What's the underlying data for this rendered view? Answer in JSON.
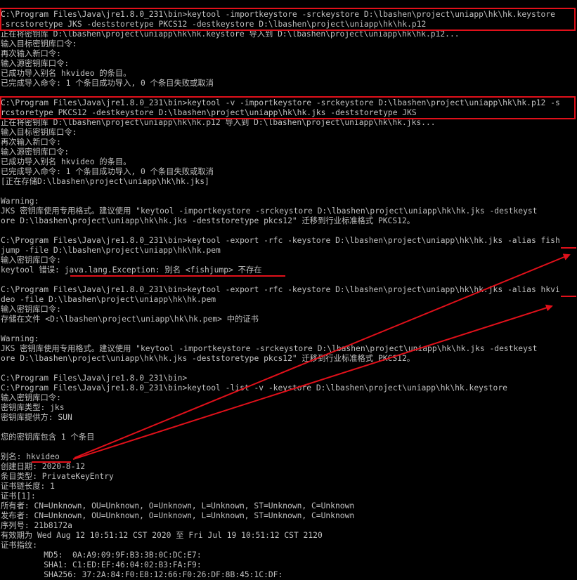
{
  "terminal": {
    "lines": [
      "C:\\Program Files\\Java\\jre1.8.0_231\\bin>keytool -importkeystore -srckeystore D:\\lbashen\\project\\uniapp\\hk\\hk.keystore",
      "-srcstoretype JKS -deststoretype PKCS12 -destkeystore D:\\lbashen\\project\\uniapp\\hk\\hk.p12",
      "正在将密钥库 D:\\lbashen\\project\\uniapp\\hk\\hk.keystore 导入到 D:\\lbashen\\project\\uniapp\\hk\\hk.p12...",
      "输入目标密钥库口令:",
      "再次输入新口令:",
      "输入源密钥库口令:",
      "已成功导入别名 hkvideo 的条目。",
      "已完成导入命令: 1 个条目成功导入, 0 个条目失败或取消",
      "",
      "C:\\Program Files\\Java\\jre1.8.0_231\\bin>keytool -v -importkeystore -srckeystore D:\\lbashen\\project\\uniapp\\hk\\hk.p12 -s",
      "rcstoretype PKCS12 -destkeystore D:\\lbashen\\project\\uniapp\\hk\\hk.jks -deststoretype JKS",
      "正在将密钥库 D:\\lbashen\\project\\uniapp\\hk\\hk.p12 导入到 D:\\lbashen\\project\\uniapp\\hk\\hk.jks...",
      "输入目标密钥库口令:",
      "再次输入新口令:",
      "输入源密钥库口令:",
      "已成功导入别名 hkvideo 的条目。",
      "已完成导入命令: 1 个条目成功导入, 0 个条目失败或取消",
      "[正在存储D:\\lbashen\\project\\uniapp\\hk\\hk.jks]",
      "",
      "Warning:",
      "JKS 密钥库使用专用格式。建议使用 \"keytool -importkeystore -srckeystore D:\\lbashen\\project\\uniapp\\hk\\hk.jks -destkeyst",
      "ore D:\\lbashen\\project\\uniapp\\hk\\hk.jks -deststoretype pkcs12\" 迁移到行业标准格式 PKCS12。",
      "",
      "C:\\Program Files\\Java\\jre1.8.0_231\\bin>keytool -export -rfc -keystore D:\\lbashen\\project\\uniapp\\hk\\hk.jks -alias fish",
      "jump -file D:\\lbashen\\project\\uniapp\\hk\\hk.pem",
      "输入密钥库口令:",
      "keytool 错误: java.lang.Exception: 别名 <fishjump> 不存在",
      "",
      "C:\\Program Files\\Java\\jre1.8.0_231\\bin>keytool -export -rfc -keystore D:\\lbashen\\project\\uniapp\\hk\\hk.jks -alias hkvi",
      "deo -file D:\\lbashen\\project\\uniapp\\hk\\hk.pem",
      "输入密钥库口令:",
      "存储在文件 <D:\\lbashen\\project\\uniapp\\hk\\hk.pem> 中的证书",
      "",
      "Warning:",
      "JKS 密钥库使用专用格式。建议使用 \"keytool -importkeystore -srckeystore D:\\lbashen\\project\\uniapp\\hk\\hk.jks -destkeyst",
      "ore D:\\lbashen\\project\\uniapp\\hk\\hk.jks -deststoretype pkcs12\" 迁移到行业标准格式 PKCS12。",
      "",
      "C:\\Program Files\\Java\\jre1.8.0_231\\bin>",
      "C:\\Program Files\\Java\\jre1.8.0_231\\bin>keytool -list -v -keystore D:\\lbashen\\project\\uniapp\\hk\\hk.keystore",
      "输入密钥库口令:",
      "密钥库类型: jks",
      "密钥库提供方: SUN",
      "",
      "您的密钥库包含 1 个条目",
      "",
      "别名: hkvideo",
      "创建日期: 2020-8-12",
      "条目类型: PrivateKeyEntry",
      "证书链长度: 1",
      "证书[1]:",
      "所有者: CN=Unknown, OU=Unknown, O=Unknown, L=Unknown, ST=Unknown, C=Unknown",
      "发布者: CN=Unknown, OU=Unknown, O=Unknown, L=Unknown, ST=Unknown, C=Unknown",
      "序列号: 21b8172a",
      "有效期为 Wed Aug 12 10:51:12 CST 2020 至 Fri Jul 19 10:51:12 CST 2120",
      "证书指纹:",
      "         MD5:  0A:A9:09:9F:B3:3B:0C:DC:E7:",
      "         SHA1: C1:ED:EF:46:04:02:B3:FA:F9:",
      "         SHA256: 37:2A:84:F0:E8:12:66:F0:26:DF:8B:45:1C:DF:"
    ]
  },
  "colors": {
    "background": "#000000",
    "text": "#c0c0c0",
    "annotation": "#e0101a"
  }
}
